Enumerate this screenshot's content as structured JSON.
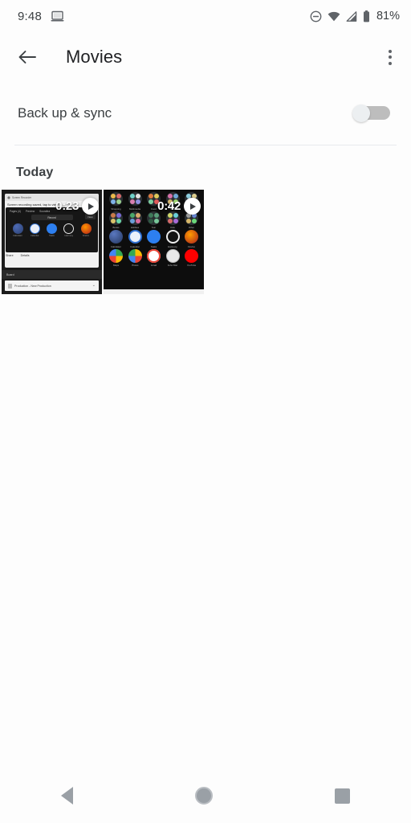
{
  "statusbar": {
    "time": "9:48",
    "cast_icon": "laptop-cast-icon",
    "dnd_icon": "do-not-disturb-icon",
    "wifi_icon": "wifi-icon",
    "signal_icon": "cellular-signal-icon",
    "battery_icon": "battery-icon",
    "battery_percent": "81%"
  },
  "appbar": {
    "back_icon": "back-arrow-icon",
    "title": "Movies",
    "overflow_icon": "more-vert-icon"
  },
  "settings": {
    "backup_label": "Back up & sync",
    "backup_enabled": false
  },
  "sections": [
    {
      "title": "Today"
    }
  ],
  "videos": [
    {
      "duration": "0:23",
      "type": "screen-recording",
      "window_title": "Screen Recorder",
      "notification_text": "Screen recording saved, tap to view",
      "tabs": [
        "Pages (4)",
        "Preview",
        "Soundtra"
      ],
      "pill_label": "Record",
      "corner_label": "New",
      "apps": [
        "Calculator",
        "Calendar",
        "Tasks",
        "Harmony",
        "Firefox"
      ],
      "actions": [
        "Share",
        "Details"
      ],
      "strip_label": "Board",
      "dropdown_text": "Production - New Production"
    },
    {
      "duration": "0:42",
      "type": "screen-recording",
      "rows": [
        [
          "Shopping",
          "Multimedia",
          "Food",
          "Tools",
          "Life"
        ],
        [
          "Books",
          "Hobbies",
          "Sun",
          "Kids",
          "Other"
        ],
        [
          "Calculator",
          "Calendar",
          "Tasks",
          "Harmony",
          "Firefox"
        ],
        [
          "Maps",
          "Photos",
          "Gmail",
          "Zoho Mail",
          "YouTube"
        ]
      ]
    }
  ],
  "navbar": {
    "back": "nav-back-button",
    "home": "nav-home-button",
    "recents": "nav-recents-button"
  },
  "colors": {
    "background": "#fdfdfd",
    "text_primary": "#202124",
    "text_secondary": "#5f6368",
    "divider": "#e8eaed",
    "switch_track": "#bdbdbd"
  }
}
